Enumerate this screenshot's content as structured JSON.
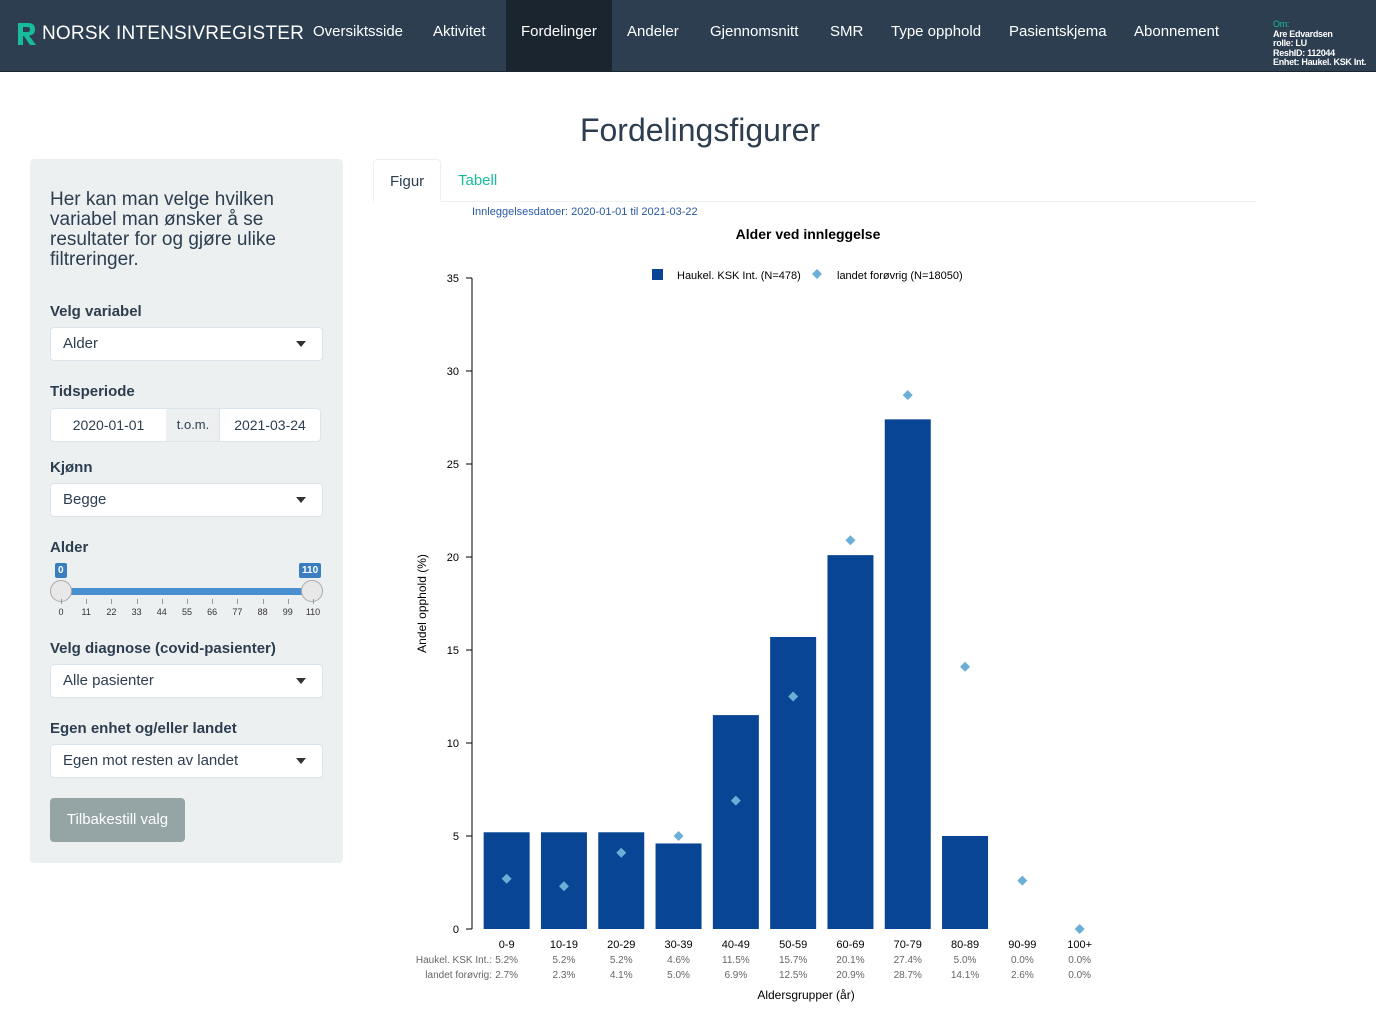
{
  "navbar": {
    "brand": "NORSK INTENSIVREGISTER",
    "items": [
      "Oversiktsside",
      "Aktivitet",
      "Fordelinger",
      "Andeler",
      "Gjennomsnitt",
      "SMR",
      "Type opphold",
      "Pasientskjema",
      "Abonnement"
    ],
    "active": "Fordelinger",
    "user": {
      "om": "Om:",
      "name": "Are Edvardsen",
      "rolle": "rolle: LU",
      "resh": "ReshID: 112044",
      "enhet": "Enhet: Haukel. KSK Int."
    }
  },
  "page": {
    "title": "Fordelingsfigurer"
  },
  "sidebar": {
    "intro": "Her kan man velge hvilken variabel man ønsker å se resultater for og gjøre ulike filtreringer.",
    "variabel": {
      "label": "Velg variabel",
      "value": "Alder"
    },
    "tidsperiode": {
      "label": "Tidsperiode",
      "from": "2020-01-01",
      "sep": "t.o.m.",
      "to": "2021-03-24"
    },
    "kjonn": {
      "label": "Kjønn",
      "value": "Begge"
    },
    "alder": {
      "label": "Alder",
      "min": 0,
      "max": 110,
      "min_label": "0",
      "max_label": "110",
      "ticks": [
        "0",
        "11",
        "22",
        "33",
        "44",
        "55",
        "66",
        "77",
        "88",
        "99",
        "110"
      ]
    },
    "diagnose": {
      "label": "Velg diagnose (covid-pasienter)",
      "value": "Alle pasienter"
    },
    "enhet": {
      "label": "Egen enhet og/eller landet",
      "value": "Egen mot resten av landet"
    },
    "reset_label": "Tilbakestill valg"
  },
  "tabs": [
    {
      "label": "Figur",
      "active": true
    },
    {
      "label": "Tabell",
      "active": false
    }
  ],
  "chart_data": {
    "type": "bar",
    "date_note": "Innleggelsesdatoer: 2020-01-01 til 2021-03-22",
    "title": "Alder ved innleggelse",
    "xlabel": "Aldersgrupper (år)",
    "ylabel": "Andel opphold (%)",
    "ylim": [
      0,
      35
    ],
    "yticks": [
      0,
      5,
      10,
      15,
      20,
      25,
      30,
      35
    ],
    "categories": [
      "0-9",
      "10-19",
      "20-29",
      "30-39",
      "40-49",
      "50-59",
      "60-69",
      "70-79",
      "80-89",
      "90-99",
      "100+"
    ],
    "series": [
      {
        "name": "Haukel. KSK Int. (N=478)",
        "row_label": "Haukel. KSK Int.:",
        "kind": "bar",
        "color": "#084594",
        "values": [
          5.2,
          5.2,
          5.2,
          4.6,
          11.5,
          15.7,
          20.1,
          27.4,
          5.0,
          0.0,
          0.0
        ],
        "labels": [
          "5.2%",
          "5.2%",
          "5.2%",
          "4.6%",
          "11.5%",
          "15.7%",
          "20.1%",
          "27.4%",
          "5.0%",
          "0.0%",
          "0.0%"
        ]
      },
      {
        "name": "landet forøvrig (N=18050)",
        "row_label": "landet forøvrig:",
        "kind": "point",
        "color": "#6baed6",
        "values": [
          2.7,
          2.3,
          4.1,
          5.0,
          6.9,
          12.5,
          20.9,
          28.7,
          14.1,
          2.6,
          0.0
        ],
        "labels": [
          "2.7%",
          "2.3%",
          "4.1%",
          "5.0%",
          "6.9%",
          "12.5%",
          "20.9%",
          "28.7%",
          "14.1%",
          "2.6%",
          "0.0%"
        ]
      }
    ],
    "grid": false,
    "legend": "top-center"
  }
}
